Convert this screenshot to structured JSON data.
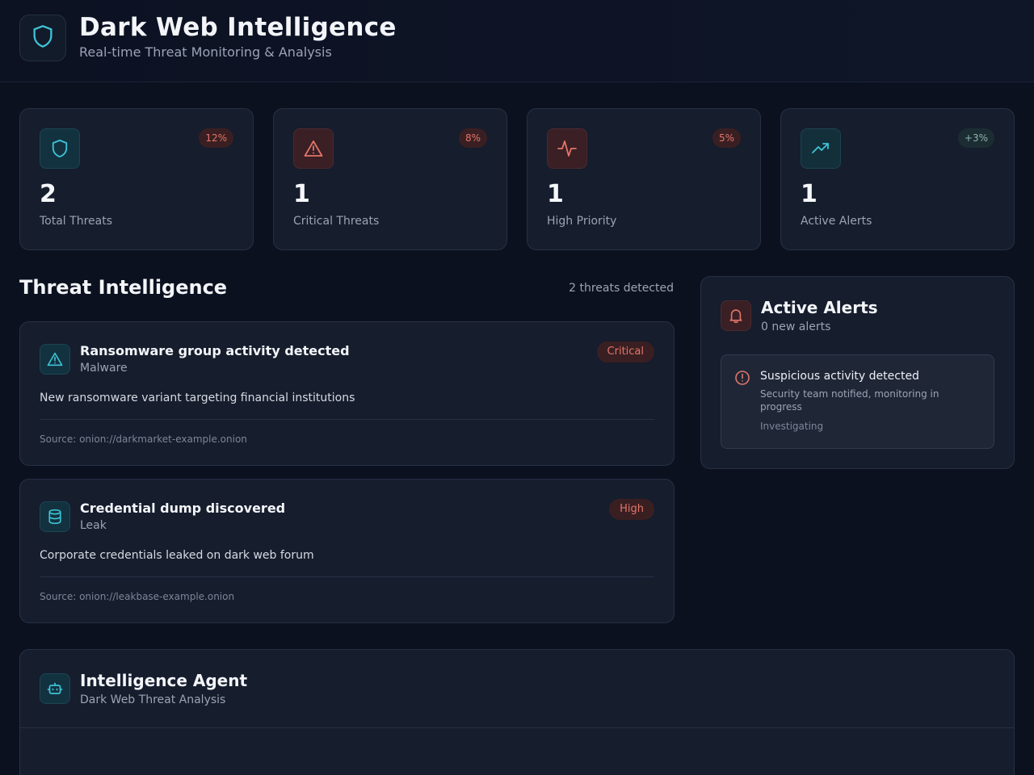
{
  "header": {
    "title": "Dark Web Intelligence",
    "subtitle": "Real-time Threat Monitoring & Analysis",
    "logo_icon": "shield-icon"
  },
  "stats": [
    {
      "icon": "shield-icon",
      "value": "2",
      "label": "Total Threats",
      "badge": "12%"
    },
    {
      "icon": "warning-triangle-icon",
      "value": "1",
      "label": "Critical Threats",
      "badge": "8%"
    },
    {
      "icon": "activity-pulse-icon",
      "value": "1",
      "label": "High Priority",
      "badge": "5%"
    },
    {
      "icon": "trending-up-icon",
      "value": "1",
      "label": "Active Alerts",
      "badge": "+3%"
    }
  ],
  "threat_section": {
    "title": "Threat Intelligence",
    "count": "2 threats detected",
    "threats": [
      {
        "icon": "warning-triangle-icon",
        "title": "Ransomware group activity detected",
        "category": "Malware",
        "severity": "Critical",
        "description": "New ransomware variant targeting financial institutions",
        "source": "Source: onion://darkmarket-example.onion"
      },
      {
        "icon": "database-icon",
        "title": "Credential dump discovered",
        "category": "Leak",
        "severity": "High",
        "description": "Corporate credentials leaked on dark web forum",
        "source": "Source: onion://leakbase-example.onion"
      }
    ]
  },
  "alerts": {
    "title": "Active Alerts",
    "subtitle": "0 new alerts",
    "items": [
      {
        "icon": "alert-circle-icon",
        "title": "Suspicious activity detected",
        "description": "Security team notified, monitoring in progress",
        "status": "Investigating"
      }
    ]
  },
  "agent": {
    "title": "Intelligence Agent",
    "subtitle": "Dark Web Threat Analysis",
    "icon": "bot-icon"
  },
  "colors": {
    "background": "#0c1120",
    "card": "#161d2d",
    "accent_teal": "#3ec4d6",
    "accent_red": "#e2766a"
  }
}
